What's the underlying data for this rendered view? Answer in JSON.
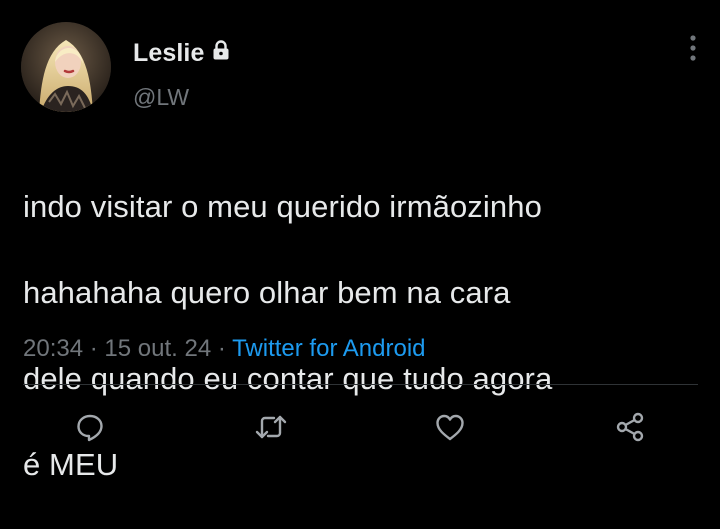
{
  "author": {
    "display_name": "Leslie",
    "handle": "@LW",
    "protected_icon": "lock-icon",
    "avatar": "profile-photo"
  },
  "tweet": {
    "text_lines": [
      "indo visitar o meu querido irmãozinho",
      "hahahaha quero olhar bem na cara",
      "dele quando eu contar que tudo agora",
      "é MEU"
    ],
    "time": "20:34",
    "separator": "·",
    "date": "15 out. 24",
    "source": "Twitter for Android"
  },
  "actions": {
    "reply_icon": "reply-icon",
    "retweet_icon": "retweet-icon",
    "like_icon": "heart-icon",
    "share_icon": "share-icon"
  },
  "overflow_menu_icon": "more-vertical-icon",
  "colors": {
    "background": "#000000",
    "text_primary": "#e7e9ea",
    "text_secondary": "#71767b",
    "link": "#1d9bf0",
    "divider": "#2f3336"
  }
}
